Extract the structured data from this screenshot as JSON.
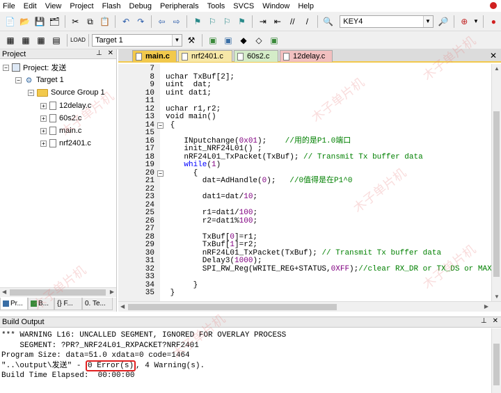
{
  "menu": [
    "File",
    "Edit",
    "View",
    "Project",
    "Flash",
    "Debug",
    "Peripherals",
    "Tools",
    "SVCS",
    "Window",
    "Help"
  ],
  "toolbar1": {
    "find_value": "KEY4"
  },
  "toolbar2": {
    "target_value": "Target 1"
  },
  "project_panel": {
    "title": "Project",
    "project_label": "Project: 发送",
    "target_label": "Target 1",
    "group_label": "Source Group 1",
    "files": [
      "12delay.c",
      "60s2.c",
      "main.c",
      "nrf2401.c"
    ],
    "tabs": [
      "Pr...",
      "B...",
      "{} F...",
      "0. Te..."
    ]
  },
  "editor": {
    "tabs": [
      {
        "label": "main.c",
        "color": "#f2c94c"
      },
      {
        "label": "nrf2401.c",
        "color": "#f7e8a8"
      },
      {
        "label": "60s2.c",
        "color": "#d4ecc8"
      },
      {
        "label": "12delay.c",
        "color": "#f2c0c0"
      }
    ],
    "lines": [
      {
        "n": "7",
        "html": ""
      },
      {
        "n": "8",
        "html": "uchar TxBuf[2];"
      },
      {
        "n": "9",
        "html": "uint  dat;"
      },
      {
        "n": "10",
        "html": "uint dat1;"
      },
      {
        "n": "11",
        "html": ""
      },
      {
        "n": "12",
        "html": "uchar r1,r2;"
      },
      {
        "n": "13",
        "html": "void main()"
      },
      {
        "n": "14",
        "html": " {",
        "fold": "-"
      },
      {
        "n": "15",
        "html": ""
      },
      {
        "n": "16",
        "html": "    INputchange(<span class=\"num\">0x01</span>);    <span class=\"cm\">//用的是P1.0端口</span>"
      },
      {
        "n": "17",
        "html": "    init_NRF24L01() ;"
      },
      {
        "n": "18",
        "html": "    nRF24L01_TxPacket(TxBuf); <span class=\"cm\">// Transmit Tx buffer data</span>"
      },
      {
        "n": "19",
        "html": "    <span class=\"kw\">while</span>(<span class=\"num\">1</span>)"
      },
      {
        "n": "20",
        "html": "      {",
        "fold": "-"
      },
      {
        "n": "21",
        "html": "        dat=AdHandle(<span class=\"num\">0</span>);   <span class=\"cm\">//0值得是在P1^0</span>"
      },
      {
        "n": "22",
        "html": ""
      },
      {
        "n": "23",
        "html": "        dat1=dat/<span class=\"num\">10</span>;"
      },
      {
        "n": "24",
        "html": ""
      },
      {
        "n": "25",
        "html": "        r1=dat1/<span class=\"num\">100</span>;"
      },
      {
        "n": "26",
        "html": "        r2=dat1%<span class=\"num\">100</span>;"
      },
      {
        "n": "27",
        "html": ""
      },
      {
        "n": "28",
        "html": "        TxBuf[<span class=\"num\">0</span>]=r1;"
      },
      {
        "n": "29",
        "html": "        TxBuf[<span class=\"num\">1</span>]=r2;"
      },
      {
        "n": "30",
        "html": "        nRF24L01_TxPacket(TxBuf); <span class=\"cm\">// Transmit Tx buffer data</span>"
      },
      {
        "n": "31",
        "html": "        Delay3(<span class=\"num\">1000</span>);"
      },
      {
        "n": "32",
        "html": "        SPI_RW_Reg(WRITE_REG+STATUS,<span class=\"num\">0XFF</span>);<span class=\"cm\">//clear RX_DR or TX_DS or MAX_RT</span>"
      },
      {
        "n": "33",
        "html": ""
      },
      {
        "n": "34",
        "html": "      }"
      },
      {
        "n": "35",
        "html": " }"
      }
    ]
  },
  "build_output": {
    "title": "Build Output",
    "line1": "*** WARNING L16: UNCALLED SEGMENT, IGNORED FOR OVERLAY PROCESS",
    "line2": "    SEGMENT: ?PR?_NRF24L01_RXPACKET?NRF2401",
    "line3": "Program Size: data=51.0 xdata=0 code=1464",
    "line4_prefix": "\"..\\output\\发送\" - ",
    "line4_errors": "0 Error(s)",
    "line4_suffix": ", 4 Warning(s).",
    "line5": "Build Time Elapsed:  00:00:00"
  },
  "watermark": "木子单片机",
  "colors": {
    "error_highlight": "#e02020",
    "active_tab_underline": "#f2c94c"
  }
}
